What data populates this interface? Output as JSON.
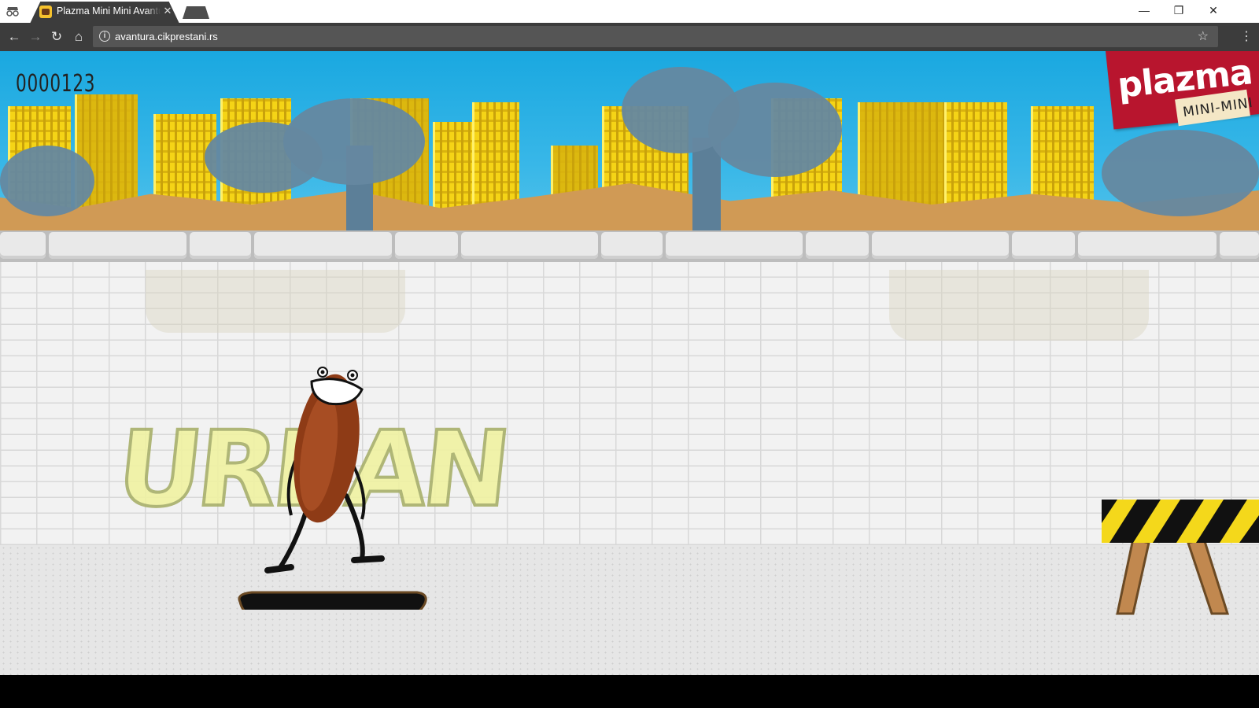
{
  "browser": {
    "tab_title": "Plazma Mini Mini Avantura",
    "tab_close": "✕",
    "url": "avantura.cikprestani.rs",
    "window_controls": {
      "minimize": "—",
      "restore": "❐",
      "close": "✕"
    },
    "nav_icons": {
      "back": "←",
      "forward": "→",
      "reload": "↻",
      "home": "⌂",
      "star": "☆",
      "menu": "⋮",
      "info": "i"
    }
  },
  "game": {
    "score": "0000123",
    "logo_brand": "plazma",
    "logo_sub": "MINI-MINI",
    "graffiti_text": "URBAN"
  },
  "colors": {
    "sky": "#1aa8e0",
    "buildings": "#f5d416",
    "trees": "#6588a0",
    "logo_red": "#b8152e",
    "barrier_yellow": "#f4d81b"
  }
}
